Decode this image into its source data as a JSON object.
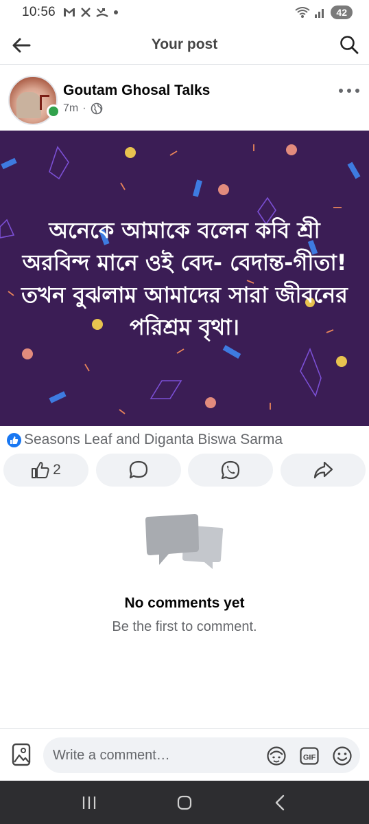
{
  "status_bar": {
    "time": "10:56",
    "left_icons": [
      "gmail-icon",
      "x-icon",
      "missed-call-icon",
      "dot-icon"
    ],
    "battery": "42"
  },
  "header": {
    "title": "Your post"
  },
  "post": {
    "author": "Goutam Ghosal Talks",
    "time": "7m",
    "separator": "·",
    "privacy_icon": "globe-icon",
    "image_text_lines": [
      "অনেকে আমাকে বলেন কবি শ্রী",
      "অরবিন্দ মানে ওই বেদ- বেদান্ত-গীতা!",
      "তখন বুঝলাম আমাদের  সারা জীবনের",
      "পরিশ্রম বৃথা।"
    ],
    "image_bg_color": "#3b1d55",
    "reaction_text": "Seasons Leaf and Diganta Biswa Sarma",
    "like_count": "2"
  },
  "comments": {
    "empty_title": "No comments yet",
    "empty_subtitle": "Be the first to comment."
  },
  "comment_bar": {
    "placeholder": "Write a comment…"
  },
  "colors": {
    "accent": "#1877f2",
    "online": "#31a24c",
    "nav_bg": "#2d2d30"
  }
}
